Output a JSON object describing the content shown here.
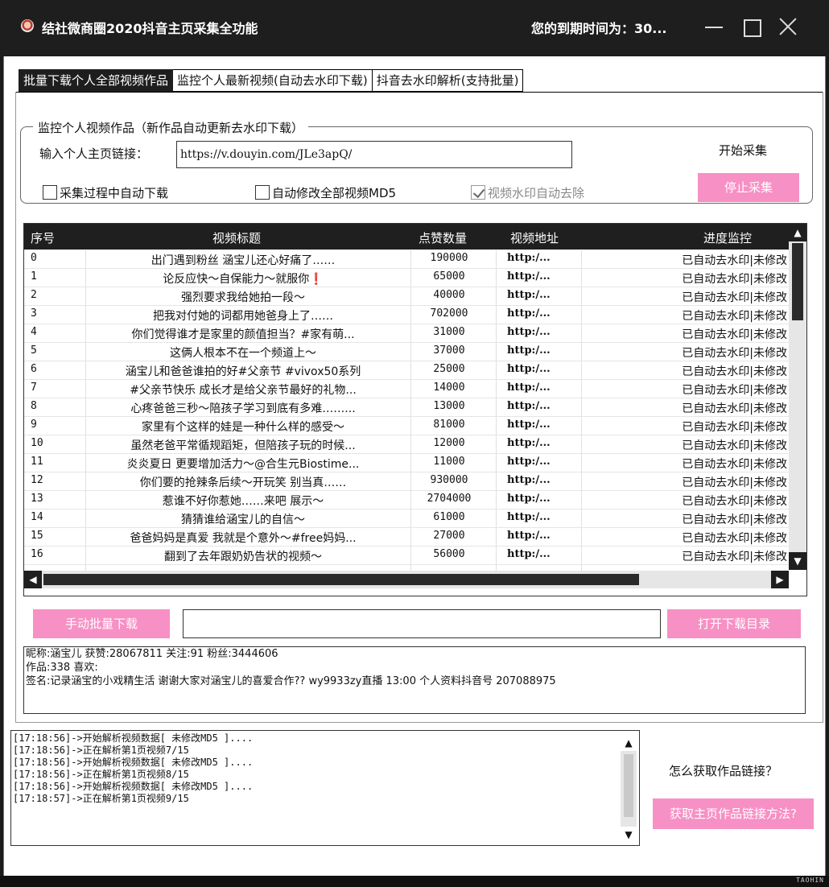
{
  "window": {
    "title": "结社微商圈2020抖音主页采集全功能",
    "expire_text": "您的到期时间为：30..."
  },
  "tabs": [
    {
      "label": "批量下载个人全部视频作品",
      "active": true
    },
    {
      "label": "监控个人最新视频(自动去水印下载)",
      "active": false
    },
    {
      "label": "抖音去水印解析(支持批量)",
      "active": false
    }
  ],
  "monitor": {
    "group_title": "监控个人视频作品（新作品自动更新去水印下载）",
    "url_label": "输入个人主页链接：",
    "url_value": "https://v.douyin.com/JLe3apQ/",
    "start_label": "开始采集",
    "stop_button": "停止采集",
    "auto_download_label": "采集过程中自动下载",
    "auto_md5_label": "自动修改全部视频MD5",
    "watermark_label": "视频水印自动去除"
  },
  "table": {
    "columns": [
      "序号",
      "视频标题",
      "点赞数量",
      "视频地址",
      "进度监控"
    ],
    "rows": [
      {
        "idx": "0",
        "title": "出门遇到粉丝 涵宝儿还心好痛了……",
        "likes": "190000",
        "url": "http:/...",
        "status": "已自动去水印|未修改"
      },
      {
        "idx": "1",
        "title": "论反应快～自保能力～就服你❗",
        "likes": "65000",
        "url": "http:/...",
        "status": "已自动去水印|未修改"
      },
      {
        "idx": "2",
        "title": "强烈要求我给她拍一段～",
        "likes": "40000",
        "url": "http:/...",
        "status": "已自动去水印|未修改"
      },
      {
        "idx": "3",
        "title": "把我对付她的词都用她爸身上了……",
        "likes": "702000",
        "url": "http:/...",
        "status": "已自动去水印|未修改"
      },
      {
        "idx": "4",
        "title": "你们觉得谁才是家里的颜值担当？#家有萌...",
        "likes": "31000",
        "url": "http:/...",
        "status": "已自动去水印|未修改"
      },
      {
        "idx": "5",
        "title": "这俩人根本不在一个频道上～",
        "likes": "37000",
        "url": "http:/...",
        "status": "已自动去水印|未修改"
      },
      {
        "idx": "6",
        "title": "涵宝儿和爸爸谁拍的好#父亲节 #vivox50系列",
        "likes": "25000",
        "url": "http:/...",
        "status": "已自动去水印|未修改"
      },
      {
        "idx": "7",
        "title": "#父亲节快乐 成长才是给父亲节最好的礼物...",
        "likes": "14000",
        "url": "http:/...",
        "status": "已自动去水印|未修改"
      },
      {
        "idx": "8",
        "title": "心疼爸爸三秒～陪孩子学习到底有多难……...",
        "likes": "13000",
        "url": "http:/...",
        "status": "已自动去水印|未修改"
      },
      {
        "idx": "9",
        "title": "家里有个这样的娃是一种什么样的感受～",
        "likes": "81000",
        "url": "http:/...",
        "status": "已自动去水印|未修改"
      },
      {
        "idx": "10",
        "title": "虽然老爸平常循规蹈矩，但陪孩子玩的时候...",
        "likes": "12000",
        "url": "http:/...",
        "status": "已自动去水印|未修改"
      },
      {
        "idx": "11",
        "title": "炎炎夏日 更要增加活力～@合生元Biostime...",
        "likes": "11000",
        "url": "http:/...",
        "status": "已自动去水印|未修改"
      },
      {
        "idx": "12",
        "title": "你们要的抢辣条后续～开玩笑 别当真……",
        "likes": "930000",
        "url": "http:/...",
        "status": "已自动去水印|未修改"
      },
      {
        "idx": "13",
        "title": "惹谁不好你惹她……来吧 展示～",
        "likes": "2704000",
        "url": "http:/...",
        "status": "已自动去水印|未修改"
      },
      {
        "idx": "14",
        "title": "猜猜谁给涵宝儿的自信～",
        "likes": "61000",
        "url": "http:/...",
        "status": "已自动去水印|未修改"
      },
      {
        "idx": "15",
        "title": "爸爸妈妈是真爱 我就是个意外～#free妈妈...",
        "likes": "27000",
        "url": "http:/...",
        "status": "已自动去水印|未修改"
      },
      {
        "idx": "16",
        "title": "翻到了去年跟奶奶告状的视频～",
        "likes": "56000",
        "url": "http:/...",
        "status": "已自动去水印|未修改"
      }
    ]
  },
  "actions": {
    "manual_download": "手动批量下载",
    "open_folder": "打开下载目录",
    "how_to_label": "怎么获取作品链接？",
    "method_button": "获取主页作品链接方法?"
  },
  "profile": {
    "line1": "昵称:涵宝儿 获赞:28067811 关注:91 粉丝:3444606",
    "line2": " 作品:338 喜欢:",
    "line3": "签名:记录涵宝的小戏精生活 谢谢大家对涵宝儿的喜爱合作?? wy9933zy直播 13:00 个人资料抖音号 207088975"
  },
  "log": [
    "[17:18:56]->开始解析视频数据[ 未修改MD5 ]....",
    "[17:18:56]->正在解析第1页视频7/15",
    "[17:18:56]->开始解析视频数据[ 未修改MD5 ]....",
    "[17:18:56]->正在解析第1页视频8/15",
    "[17:18:56]->开始解析视频数据[ 未修改MD5 ]....",
    "[17:18:57]->正在解析第1页视频9/15"
  ],
  "footer": {
    "brand": "TAOHIN"
  },
  "colors": {
    "accent_pink": "#f790c4",
    "dark": "#1e1e1e"
  }
}
